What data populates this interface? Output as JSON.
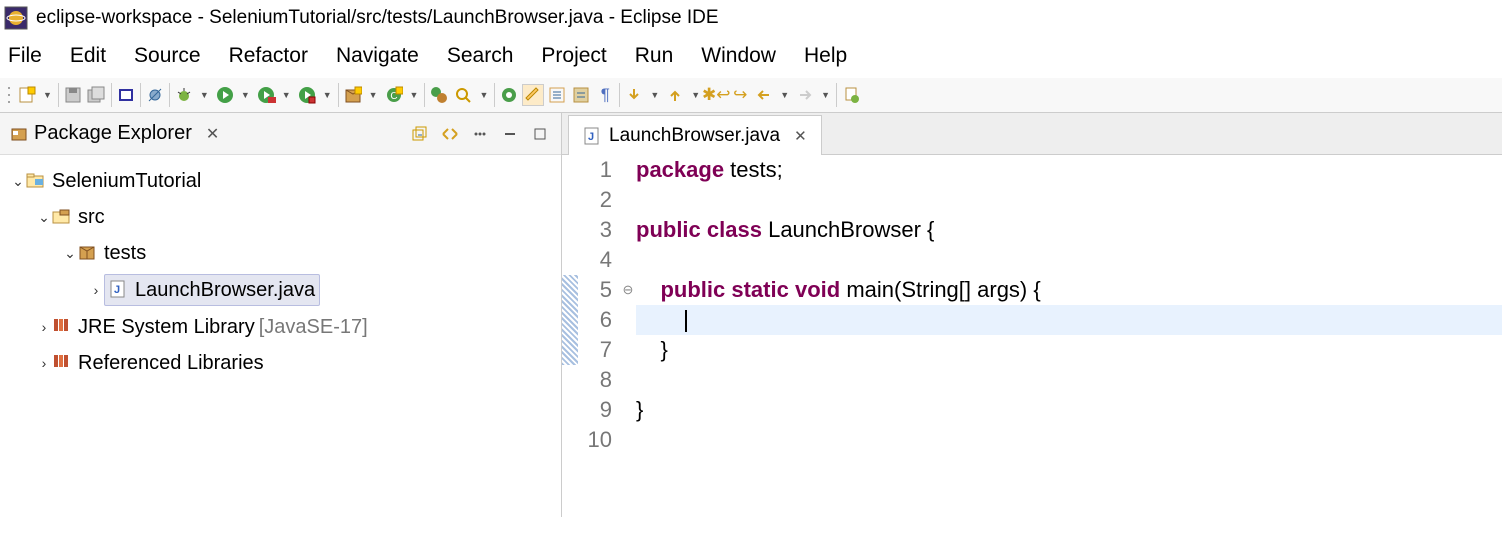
{
  "title": "eclipse-workspace - SeleniumTutorial/src/tests/LaunchBrowser.java - Eclipse IDE",
  "menu": [
    "File",
    "Edit",
    "Source",
    "Refactor",
    "Navigate",
    "Search",
    "Project",
    "Run",
    "Window",
    "Help"
  ],
  "explorer": {
    "title": "Package Explorer",
    "project": "SeleniumTutorial",
    "src": "src",
    "pkg": "tests",
    "file": "LaunchBrowser.java",
    "jre": "JRE System Library",
    "jreVer": "[JavaSE-17]",
    "refLib": "Referenced Libraries"
  },
  "tab": "LaunchBrowser.java",
  "code": {
    "l1a": "package",
    "l1b": " tests;",
    "l3a": "public",
    "l3b": " ",
    "l3c": "class",
    "l3d": " LaunchBrowser {",
    "l5a": "public",
    "l5b": " ",
    "l5c": "static",
    "l5d": " ",
    "l5e": "void",
    "l5f": " main(String[] args) {",
    "l7": "    }",
    "l9": "}",
    "indent5": "    ",
    "indent6": "        "
  },
  "ln": {
    "1": "1",
    "2": "2",
    "3": "3",
    "4": "4",
    "5": "5",
    "6": "6",
    "7": "7",
    "8": "8",
    "9": "9",
    "10": "10"
  }
}
